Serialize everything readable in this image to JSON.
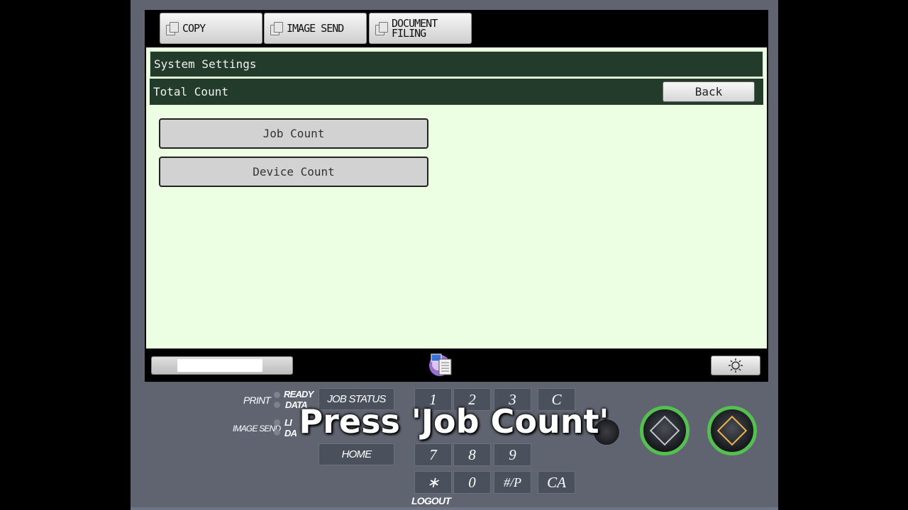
{
  "tabs": [
    {
      "label": "COPY"
    },
    {
      "label": "IMAGE SEND"
    },
    {
      "label": "DOCUMENT\nFILING"
    }
  ],
  "header": {
    "title": "System Settings"
  },
  "subheader": {
    "title": "Total Count",
    "back_label": "Back"
  },
  "menu": [
    {
      "label": "Job Count"
    },
    {
      "label": "Device Count"
    }
  ],
  "status": {
    "progress_fraction": 0.6
  },
  "panel": {
    "print_label": "PRINT",
    "image_send_label": "IMAGE SEND",
    "ready_label": "READY",
    "data_label": "DATA",
    "line_label_partial": "LI",
    "data2_label_partial": "DA",
    "job_status_label": "JOB STATUS",
    "home_label": "HOME",
    "logout_label": "LOGOUT",
    "keys_row1": [
      "1",
      "2",
      "3",
      "C"
    ],
    "keys_row3": [
      "7",
      "8",
      "9"
    ],
    "keys_row4": [
      "∗",
      "0",
      "#/P",
      "CA"
    ]
  },
  "caption": "Press 'Job Count'",
  "colors": {
    "start_ring": "#54c04f",
    "panel_bg": "#ecffe2",
    "bar_bg": "#233b2a"
  }
}
